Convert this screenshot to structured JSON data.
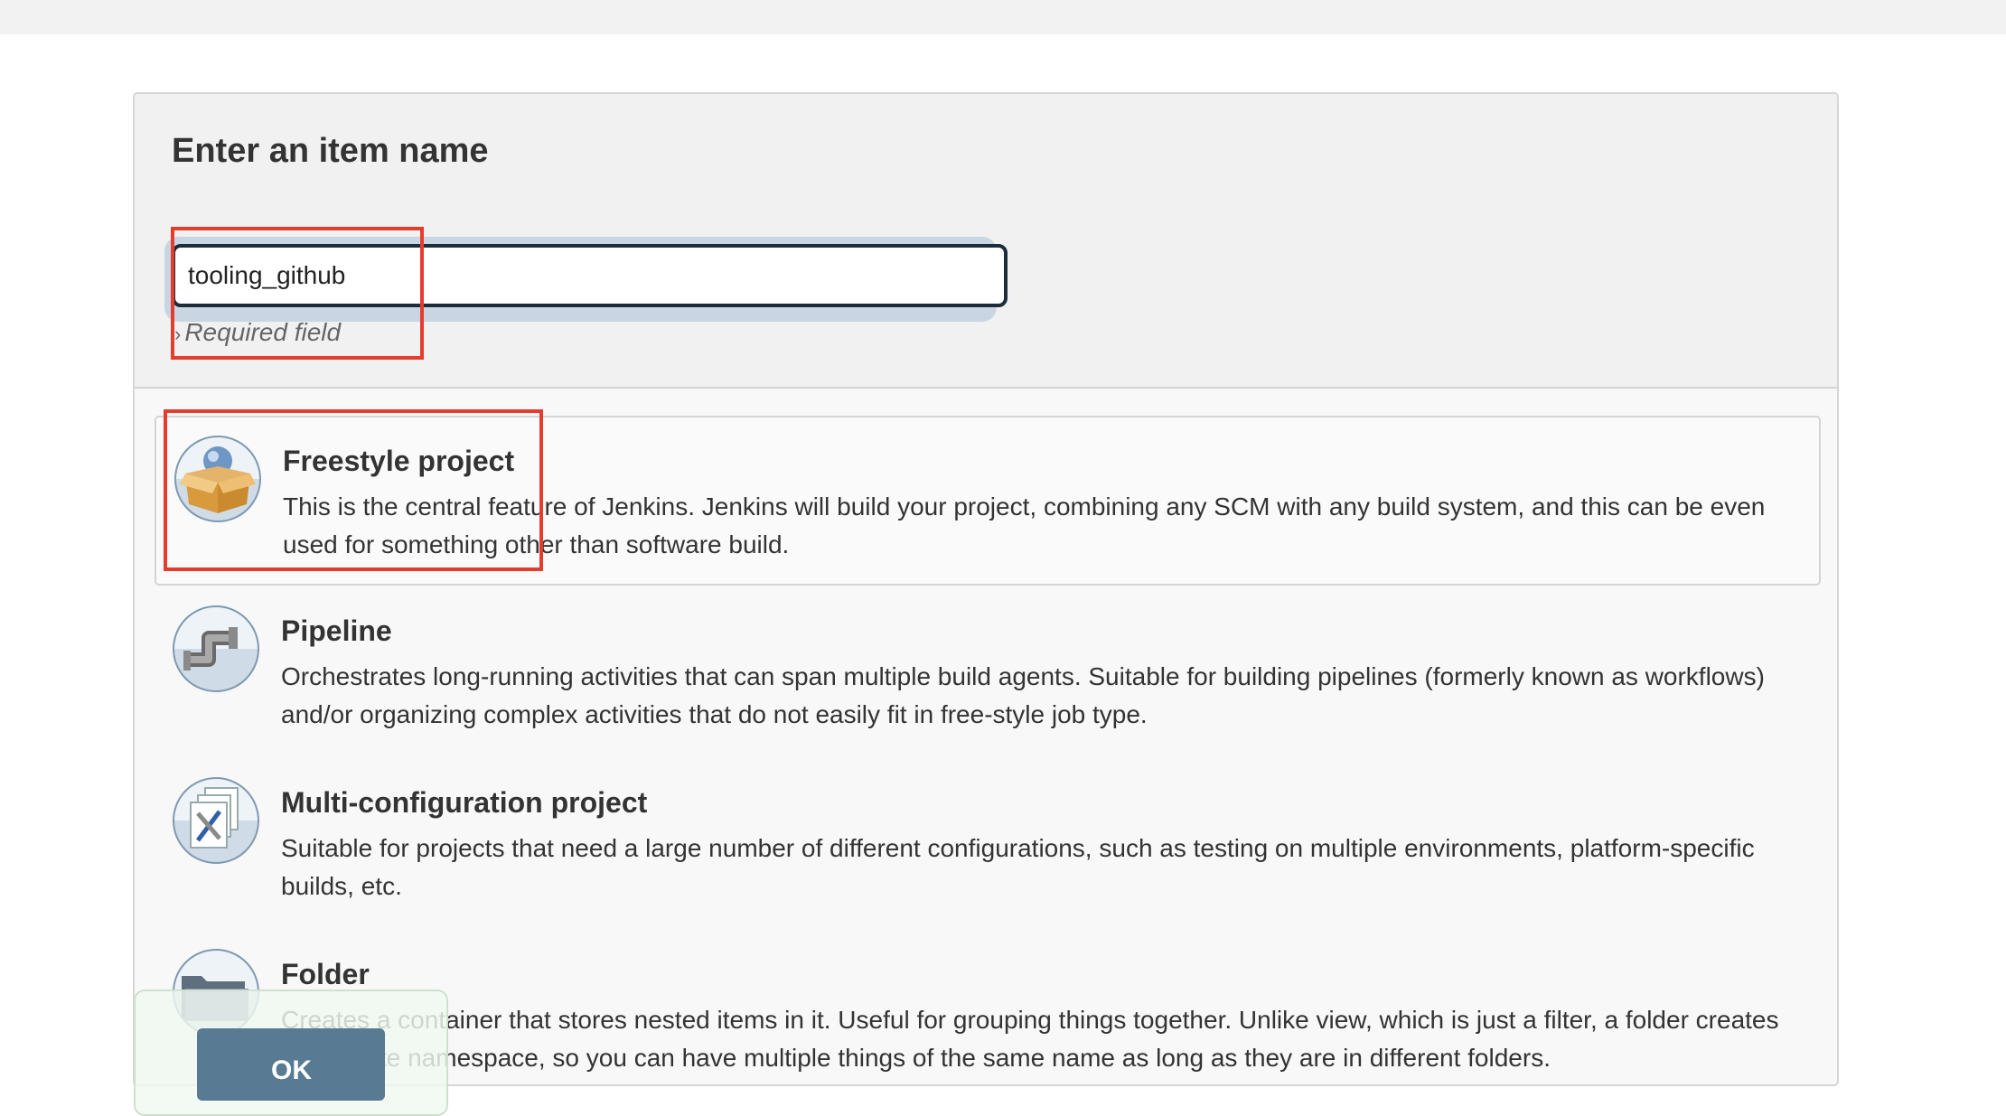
{
  "page": {
    "heading": "Enter an item name"
  },
  "name_field": {
    "value": "tooling_github",
    "hint_chevron": "›",
    "hint": "Required field"
  },
  "items": [
    {
      "title": "Freestyle project",
      "description": "This is the central feature of Jenkins. Jenkins will build your project, combining any SCM with any build system, and this can be even used for something other than software build.",
      "icon": "freestyle-box-icon",
      "selected": true
    },
    {
      "title": "Pipeline",
      "description": "Orchestrates long-running activities that can span multiple build agents. Suitable for building pipelines (formerly known as workflows) and/or organizing complex activities that do not easily fit in free-style job type.",
      "icon": "pipeline-pipe-icon"
    },
    {
      "title": "Multi-configuration project",
      "description": "Suitable for projects that need a large number of different configurations, such as testing on multiple environments, platform-specific builds, etc.",
      "icon": "multi-config-tools-icon"
    },
    {
      "title": "Folder",
      "description": "Creates a container that stores nested items in it. Useful for grouping things together. Unlike view, which is just a filter, a folder creates a separate namespace, so you can have multiple things of the same name as long as they are in different folders.",
      "icon": "folder-icon"
    }
  ],
  "ok_button": {
    "label": "OK"
  },
  "colors": {
    "annotation": "#e53c2e",
    "ok_button": "#587a93",
    "input_border": "#1d2c3a"
  }
}
